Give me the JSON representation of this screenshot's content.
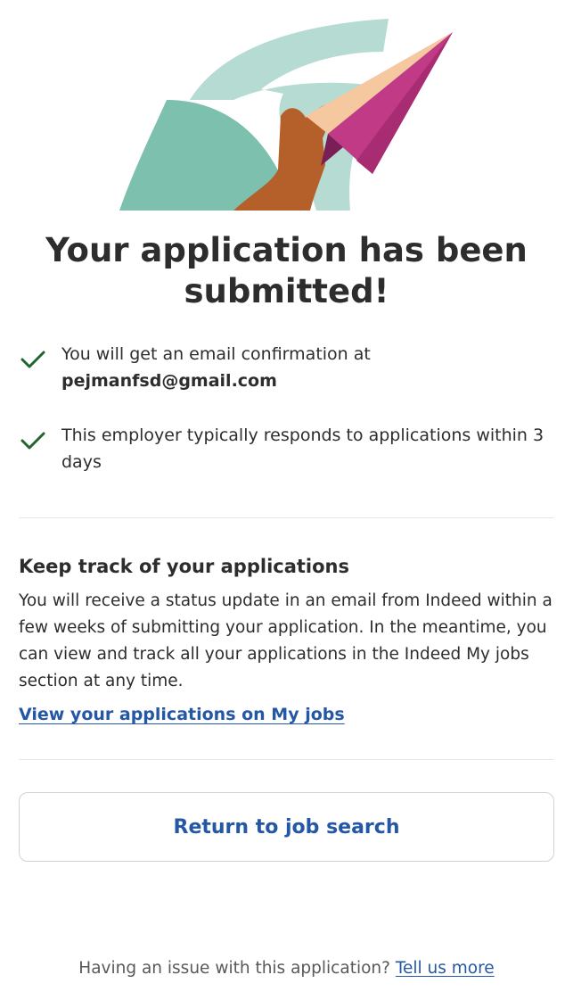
{
  "confirmation": {
    "title": "Your application has been submitted!",
    "checks": [
      {
        "text": "You will get an email confirmation at",
        "email": "pejmanfsd@gmail.com"
      },
      {
        "text": "This employer typically responds to applications within 3 days"
      }
    ]
  },
  "track": {
    "heading": "Keep track of your applications",
    "body": "You will receive a status update in an email from Indeed within a few weeks of submitting your application. In the meantime, you can view and track all your applications in the Indeed My jobs section at any time.",
    "link": "View your applications on My jobs"
  },
  "actions": {
    "return_label": "Return to job search"
  },
  "footer": {
    "text": "Having an issue with this application? ",
    "link": "Tell us more"
  },
  "colors": {
    "link": "#2557a7",
    "check": "#1f662c",
    "text": "#2d2d2d"
  },
  "icons": {
    "hero": "paper-plane-hand-illustration",
    "check": "checkmark-icon"
  }
}
